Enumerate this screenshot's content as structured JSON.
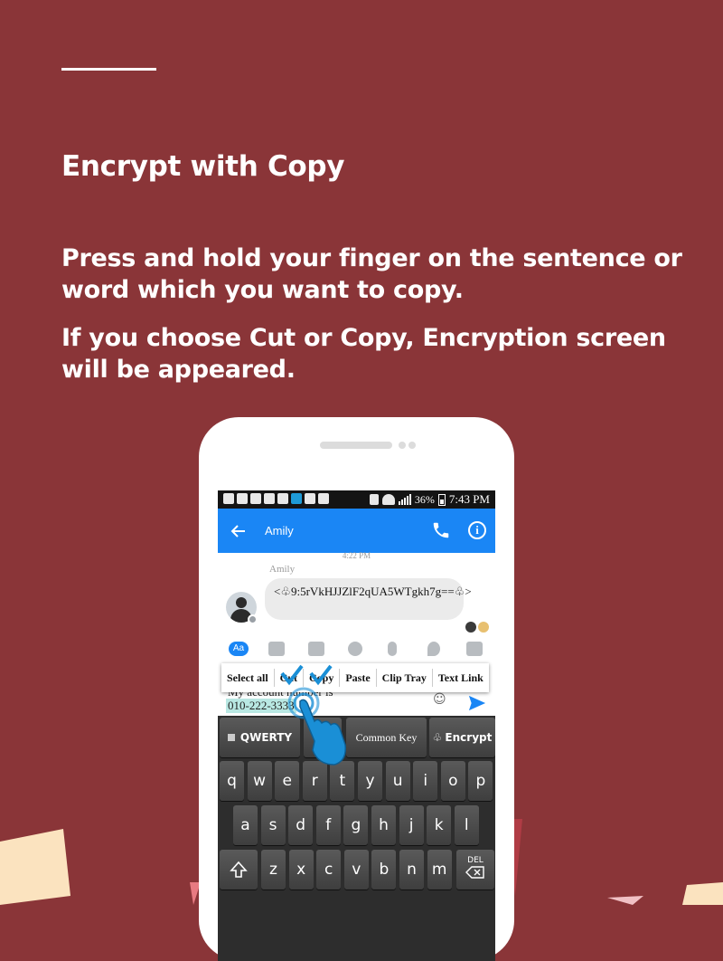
{
  "page": {
    "title": "Encrypt with Copy",
    "paragraph1": "Press and hold your finger on the sentence or word which you want to copy.",
    "paragraph2": "If you choose Cut or Copy, Encryption screen will be appeared."
  },
  "colors": {
    "background": "#8a3538",
    "app_bar": "#1a86f5",
    "highlight": "#b9e8e3",
    "touch_hand": "#1a8fd6"
  },
  "status_bar": {
    "battery": "36%",
    "time": "7:43 PM"
  },
  "app_bar": {
    "back_icon": "arrow-left-icon",
    "contact_name": "Amily",
    "call_icon": "phone-icon",
    "info_icon": "info-icon",
    "info_glyph": "i"
  },
  "chat": {
    "timestamp": "4:22 PM",
    "sender": "Amily",
    "message": "<♧9:5rVkHJJZlF2qUA5WTgkh7g==♧>"
  },
  "context_menu": {
    "items": [
      "Select all",
      "Cut",
      "Copy",
      "Paste",
      "Clip Tray",
      "Text Link"
    ]
  },
  "input": {
    "line1": "My account number is",
    "line2": "010-222-3333"
  },
  "keyboard": {
    "mode_keys": [
      "QWERTY",
      "Common Key",
      "Encrypt"
    ],
    "row1": [
      "q",
      "w",
      "e",
      "r",
      "t",
      "y",
      "u",
      "i",
      "o",
      "p"
    ],
    "row2": [
      "a",
      "s",
      "d",
      "f",
      "g",
      "h",
      "j",
      "k",
      "l"
    ],
    "row3": [
      "z",
      "x",
      "c",
      "v",
      "b",
      "n",
      "m"
    ],
    "del_label": "DEL",
    "shift_icon": "shift-arrow-icon"
  }
}
